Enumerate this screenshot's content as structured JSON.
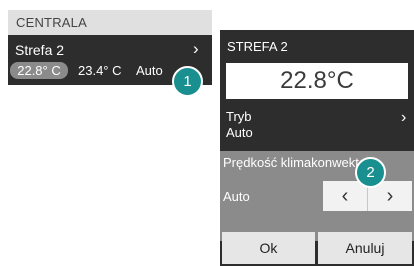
{
  "left_panel": {
    "header": "CENTRALA",
    "zone_name": "Strefa 2",
    "current_temp": "22.8° C",
    "set_temp": "23.4° C",
    "mode": "Auto",
    "arrow": "›"
  },
  "callouts": {
    "one": "1",
    "two": "2"
  },
  "right_panel": {
    "title": "STREFA 2",
    "temperature": "22.8°C",
    "mode_label": "Tryb",
    "mode_value": "Auto",
    "mode_arrow": "›",
    "speed_label": "Prędkość klimakonwektora",
    "speed_value": "Auto",
    "prev_icon": "‹",
    "next_icon": "›",
    "ok_label": "Ok",
    "cancel_label": "Anuluj"
  },
  "colors": {
    "panel_dark": "#2d2d2d",
    "panel_grey": "#8b8b8b",
    "callout_teal": "#1a8f8f"
  },
  "icons": {
    "zone_arrow": "chevron-right-icon",
    "prev": "chevron-left-icon",
    "next": "chevron-right-icon"
  }
}
